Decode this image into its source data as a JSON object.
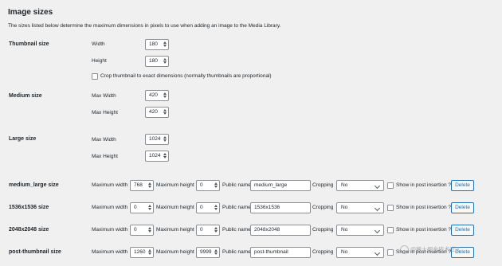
{
  "title": "Image sizes",
  "description": "The sizes listed below determine the maximum dimensions in pixels to use when adding an image to the Media Library.",
  "thumbnail": {
    "label": "Thumbnail size",
    "width_label": "Width",
    "width": "180",
    "height_label": "Height",
    "height": "180",
    "crop_label": "Crop thumbnail to exact dimensions (normally thumbnails are proportional)"
  },
  "medium": {
    "label": "Medium size",
    "width_label": "Max Width",
    "width": "420",
    "height_label": "Max Height",
    "height": "420"
  },
  "large": {
    "label": "Large size",
    "width_label": "Max Width",
    "width": "1024",
    "height_label": "Max Height",
    "height": "1024"
  },
  "custom_labels": {
    "max_width": "Maximum width",
    "max_height": "Maximum height",
    "public_name": "Public name",
    "cropping": "Cropping",
    "show": "Show in post insertion ?",
    "delete": "Delete"
  },
  "custom_sizes": [
    {
      "label": "medium_large size",
      "width": "768",
      "height": "0",
      "public_name": "medium_large",
      "cropping": "No",
      "show": "Show in post insertion ?"
    },
    {
      "label": "1536x1536 size",
      "width": "0",
      "height": "0",
      "public_name": "1536x1536",
      "cropping": "No",
      "show": "Show in post insertion ?"
    },
    {
      "label": "2048x2048 size",
      "width": "0",
      "height": "0",
      "public_name": "2048x2048",
      "cropping": "No",
      "show": "Show in post insertion ?"
    },
    {
      "label": "post-thumbnail size",
      "width": "1260",
      "height": "9999",
      "public_name": "post-thumbnail",
      "cropping": "No",
      "show": "Show in post insertion ?"
    }
  ],
  "watermark": "@稀土掘金技术社区"
}
